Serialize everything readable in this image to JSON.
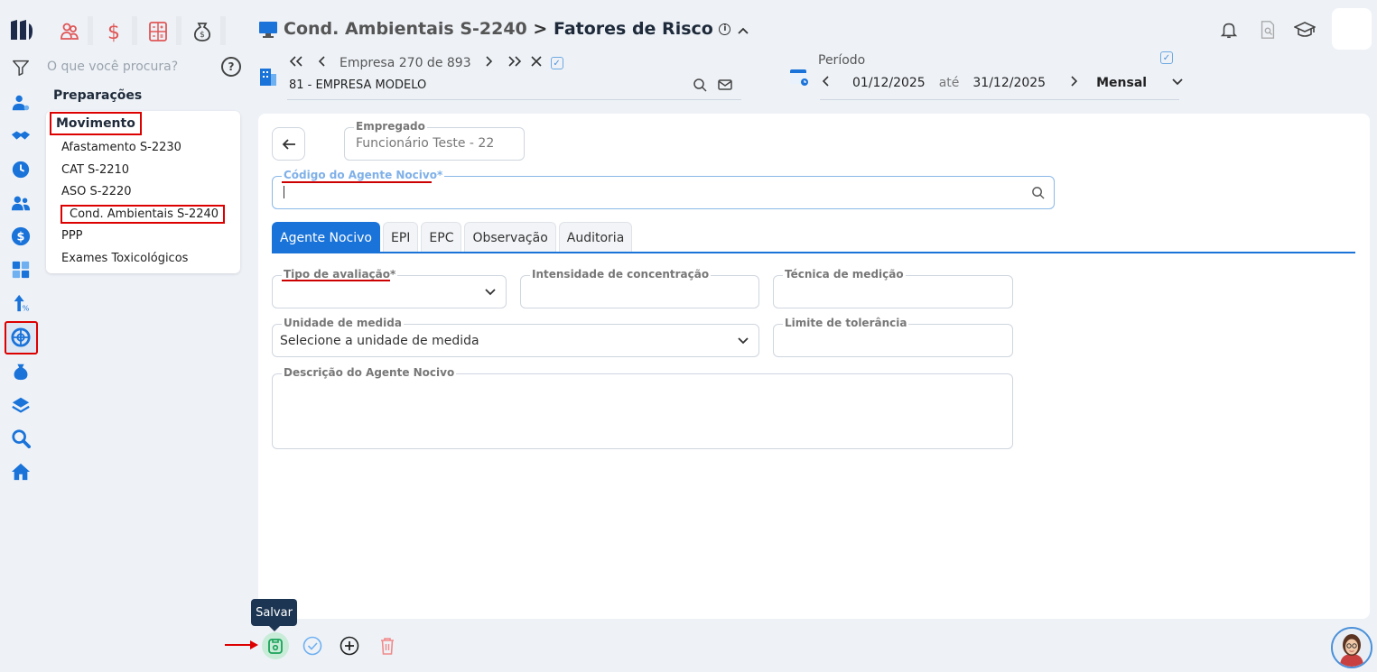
{
  "modules": [
    {
      "name": "people-icon",
      "color": "#e05656"
    },
    {
      "name": "dollar-icon",
      "color": "#e05656"
    },
    {
      "name": "calculator-icon",
      "color": "#e05656"
    },
    {
      "name": "money-bag-icon",
      "color": "#444444"
    }
  ],
  "search": {
    "placeholder": "O que você procura?"
  },
  "help": {
    "label": "?"
  },
  "menu": {
    "section_title": "Preparações",
    "active_group": "Movimento",
    "items": [
      "Afastamento S-2230",
      "CAT S-2210",
      "ASO S-2220",
      "Cond. Ambientais S-2240",
      "PPP",
      "Exames Toxicológicos"
    ]
  },
  "header": {
    "module": "Cond. Ambientais S-2240",
    "separator": ">",
    "page": "Fatores de Risco"
  },
  "company": {
    "position_label": "Empresa 270 de 893",
    "name": "81 - EMPRESA MODELO"
  },
  "period": {
    "label": "Período",
    "start": "01/12/2025",
    "connector": "até",
    "end": "31/12/2025",
    "mode": "Mensal"
  },
  "form": {
    "employee_label": "Empregado",
    "employee_value": "Funcionário Teste - 22",
    "agent_code_label": "Código do Agente Nocivo*",
    "tabs": [
      "Agente Nocivo",
      "EPI",
      "EPC",
      "Observação",
      "Auditoria"
    ],
    "eval_type_label": "Tipo de avaliação*",
    "intensity_label": "Intensidade de concentração",
    "technique_label": "Técnica de medição",
    "unit_label": "Unidade de medida",
    "unit_placeholder": "Selecione a unidade de medida",
    "limit_label": "Limite de tolerância",
    "description_label": "Descrição do Agente Nocivo"
  },
  "toolbar": {
    "save_tooltip": "Salvar"
  },
  "colors": {
    "accent": "#1a73d9",
    "highlight": "#dd0000",
    "brand": "#1e2a4a"
  }
}
